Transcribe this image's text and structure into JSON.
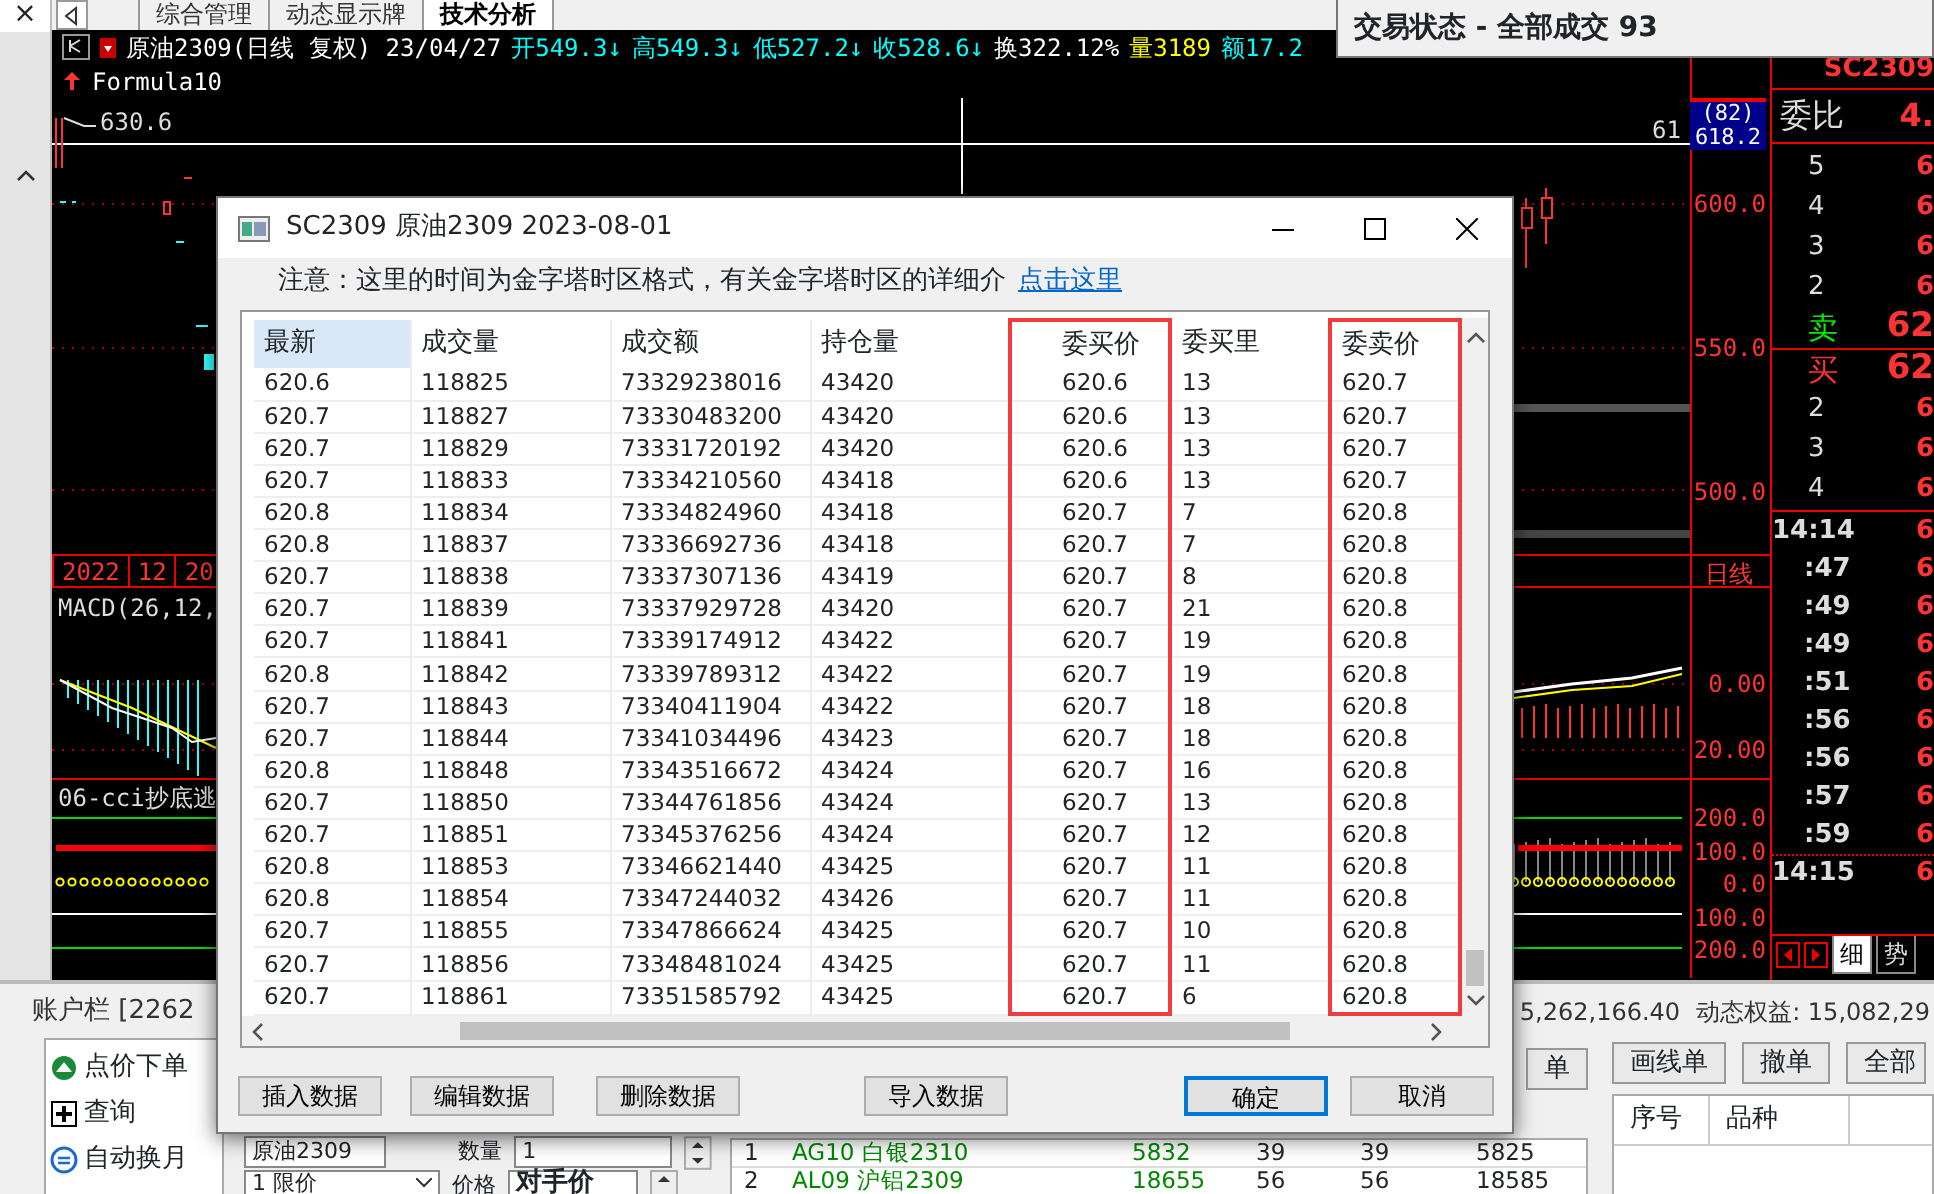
{
  "left_strip": {
    "close": "×"
  },
  "tabs": [
    {
      "label": "综合管理",
      "selected": false
    },
    {
      "label": "动态显示牌",
      "selected": false
    },
    {
      "label": "技术分析",
      "selected": true
    }
  ],
  "status_window": {
    "title": "交易状态 - 全部成交 93"
  },
  "chart": {
    "info": [
      {
        "text": "原油2309(日线 复权) 23/04/27",
        "color": "#ffffff"
      },
      {
        "text": "开549.3↓",
        "color": "#00ffff"
      },
      {
        "text": "高549.3↓",
        "color": "#00ffff"
      },
      {
        "text": "低527.2↓",
        "color": "#00ffff"
      },
      {
        "text": "收528.6↓",
        "color": "#00ffff"
      },
      {
        "text": "换322.12%",
        "color": "#ffffff"
      },
      {
        "text": "量3189",
        "color": "#ffff00"
      },
      {
        "text": "额17.2",
        "color": "#00ffff"
      }
    ],
    "formula": "Formula10",
    "high_label": "630.6",
    "last_label": "61",
    "price_box": {
      "count": "(82)",
      "price": "618.2"
    },
    "price_axis": [
      "600.0",
      "550.0",
      "500.0"
    ],
    "time_axis": [
      "2022",
      "12",
      "20"
    ],
    "period": "日线",
    "macd": {
      "title": "MACD(26,12,",
      "axis": [
        "0.00",
        "20.00"
      ]
    },
    "cci": {
      "title": "06-cci抄底逃",
      "axis": [
        "200.0",
        "100.0",
        "0.0",
        "100.0",
        "200.0"
      ]
    }
  },
  "quote_panel": {
    "symbol": "SC2309",
    "ratio_label": "委比",
    "ratio": "4.",
    "sell_levels": [
      {
        "label": "5",
        "price": "6"
      },
      {
        "label": "4",
        "price": "6"
      },
      {
        "label": "3",
        "price": "6"
      },
      {
        "label": "2",
        "price": "6"
      },
      {
        "label": "卖",
        "price": "62",
        "kind": "best"
      }
    ],
    "buy_levels": [
      {
        "label": "买",
        "price": "62",
        "kind": "best"
      },
      {
        "label": "2",
        "price": "6"
      },
      {
        "label": "3",
        "price": "6"
      },
      {
        "label": "4",
        "price": "6"
      }
    ],
    "ticks": [
      {
        "time": "14:14",
        "price": "6"
      },
      {
        "time": ":47",
        "price": "6"
      },
      {
        "time": ":49",
        "price": "6"
      },
      {
        "time": ":49",
        "price": "6"
      },
      {
        "time": ":51",
        "price": "6"
      },
      {
        "time": ":56",
        "price": "6"
      },
      {
        "time": ":56",
        "price": "6"
      },
      {
        "time": ":57",
        "price": "6"
      },
      {
        "time": ":59",
        "price": "6"
      },
      {
        "time": "14:15",
        "price": "6"
      }
    ],
    "tabs": [
      {
        "label": "细",
        "selected": true
      },
      {
        "label": "势",
        "selected": false
      }
    ]
  },
  "account_bar": {
    "title": "账户栏 [2262",
    "balance": "5,262,166.40",
    "equity": "动态权益: 15,082,29"
  },
  "order_buttons": [
    "单",
    "画线单",
    "撤单",
    "全部"
  ],
  "order_menu": [
    {
      "label": "点价下单"
    },
    {
      "label": "查询"
    },
    {
      "label": "自动换月"
    }
  ],
  "order_form": {
    "contract": "原油2309",
    "qty_label": "数量",
    "qty": "1",
    "type": "1 限价",
    "price_label": "价格",
    "price": "对手价"
  },
  "positions": [
    [
      "1",
      "AG10 白银2310",
      "5832",
      "39",
      "39",
      "5825"
    ],
    [
      "2",
      "AL09 沪铝2309",
      "18655",
      "56",
      "56",
      "18585"
    ]
  ],
  "orders_table": {
    "columns": [
      "序号",
      "品种"
    ]
  },
  "dialog": {
    "title": "SC2309 原油2309 2023-08-01",
    "note": "注意：这里的时间为金字塔时区格式，有关金字塔时区的详细介",
    "link": "点击这里",
    "table": {
      "columns": [
        {
          "label": "最新",
          "highlighted": false
        },
        {
          "label": "成交量",
          "highlighted": false
        },
        {
          "label": "成交额",
          "highlighted": false
        },
        {
          "label": "持仓量",
          "highlighted": false
        },
        {
          "label": "委买价",
          "highlighted": true
        },
        {
          "label": "委买里",
          "highlighted": false
        },
        {
          "label": "委卖价",
          "highlighted": true
        }
      ],
      "rows": [
        [
          "620.6",
          "118825",
          "73329238016",
          "43420",
          "620.6",
          "13",
          "620.7"
        ],
        [
          "620.7",
          "118827",
          "73330483200",
          "43420",
          "620.6",
          "13",
          "620.7"
        ],
        [
          "620.7",
          "118829",
          "73331720192",
          "43420",
          "620.6",
          "13",
          "620.7"
        ],
        [
          "620.7",
          "118833",
          "73334210560",
          "43418",
          "620.6",
          "13",
          "620.7"
        ],
        [
          "620.8",
          "118834",
          "73334824960",
          "43418",
          "620.7",
          "7",
          "620.8"
        ],
        [
          "620.8",
          "118837",
          "73336692736",
          "43418",
          "620.7",
          "7",
          "620.8"
        ],
        [
          "620.7",
          "118838",
          "73337307136",
          "43419",
          "620.7",
          "8",
          "620.8"
        ],
        [
          "620.7",
          "118839",
          "73337929728",
          "43420",
          "620.7",
          "21",
          "620.8"
        ],
        [
          "620.7",
          "118841",
          "73339174912",
          "43422",
          "620.7",
          "19",
          "620.8"
        ],
        [
          "620.8",
          "118842",
          "73339789312",
          "43422",
          "620.7",
          "19",
          "620.8"
        ],
        [
          "620.7",
          "118843",
          "73340411904",
          "43422",
          "620.7",
          "18",
          "620.8"
        ],
        [
          "620.7",
          "118844",
          "73341034496",
          "43423",
          "620.7",
          "18",
          "620.8"
        ],
        [
          "620.8",
          "118848",
          "73343516672",
          "43424",
          "620.7",
          "16",
          "620.8"
        ],
        [
          "620.7",
          "118850",
          "73344761856",
          "43424",
          "620.7",
          "13",
          "620.8"
        ],
        [
          "620.7",
          "118851",
          "73345376256",
          "43424",
          "620.7",
          "12",
          "620.8"
        ],
        [
          "620.8",
          "118853",
          "73346621440",
          "43425",
          "620.7",
          "11",
          "620.8"
        ],
        [
          "620.8",
          "118854",
          "73347244032",
          "43426",
          "620.7",
          "11",
          "620.8"
        ],
        [
          "620.7",
          "118855",
          "73347866624",
          "43425",
          "620.7",
          "10",
          "620.8"
        ],
        [
          "620.7",
          "118856",
          "73348481024",
          "43425",
          "620.7",
          "11",
          "620.8"
        ],
        [
          "620.7",
          "118861",
          "73351585792",
          "43425",
          "620.7",
          "6",
          "620.8"
        ]
      ]
    },
    "buttons": [
      {
        "label": "插入数据",
        "default": false
      },
      {
        "label": "编辑数据",
        "default": false
      },
      {
        "label": "删除数据",
        "default": false
      },
      {
        "label": "导入数据",
        "default": false
      },
      {
        "label": "确定",
        "default": true
      },
      {
        "label": "取消",
        "default": false
      }
    ]
  }
}
